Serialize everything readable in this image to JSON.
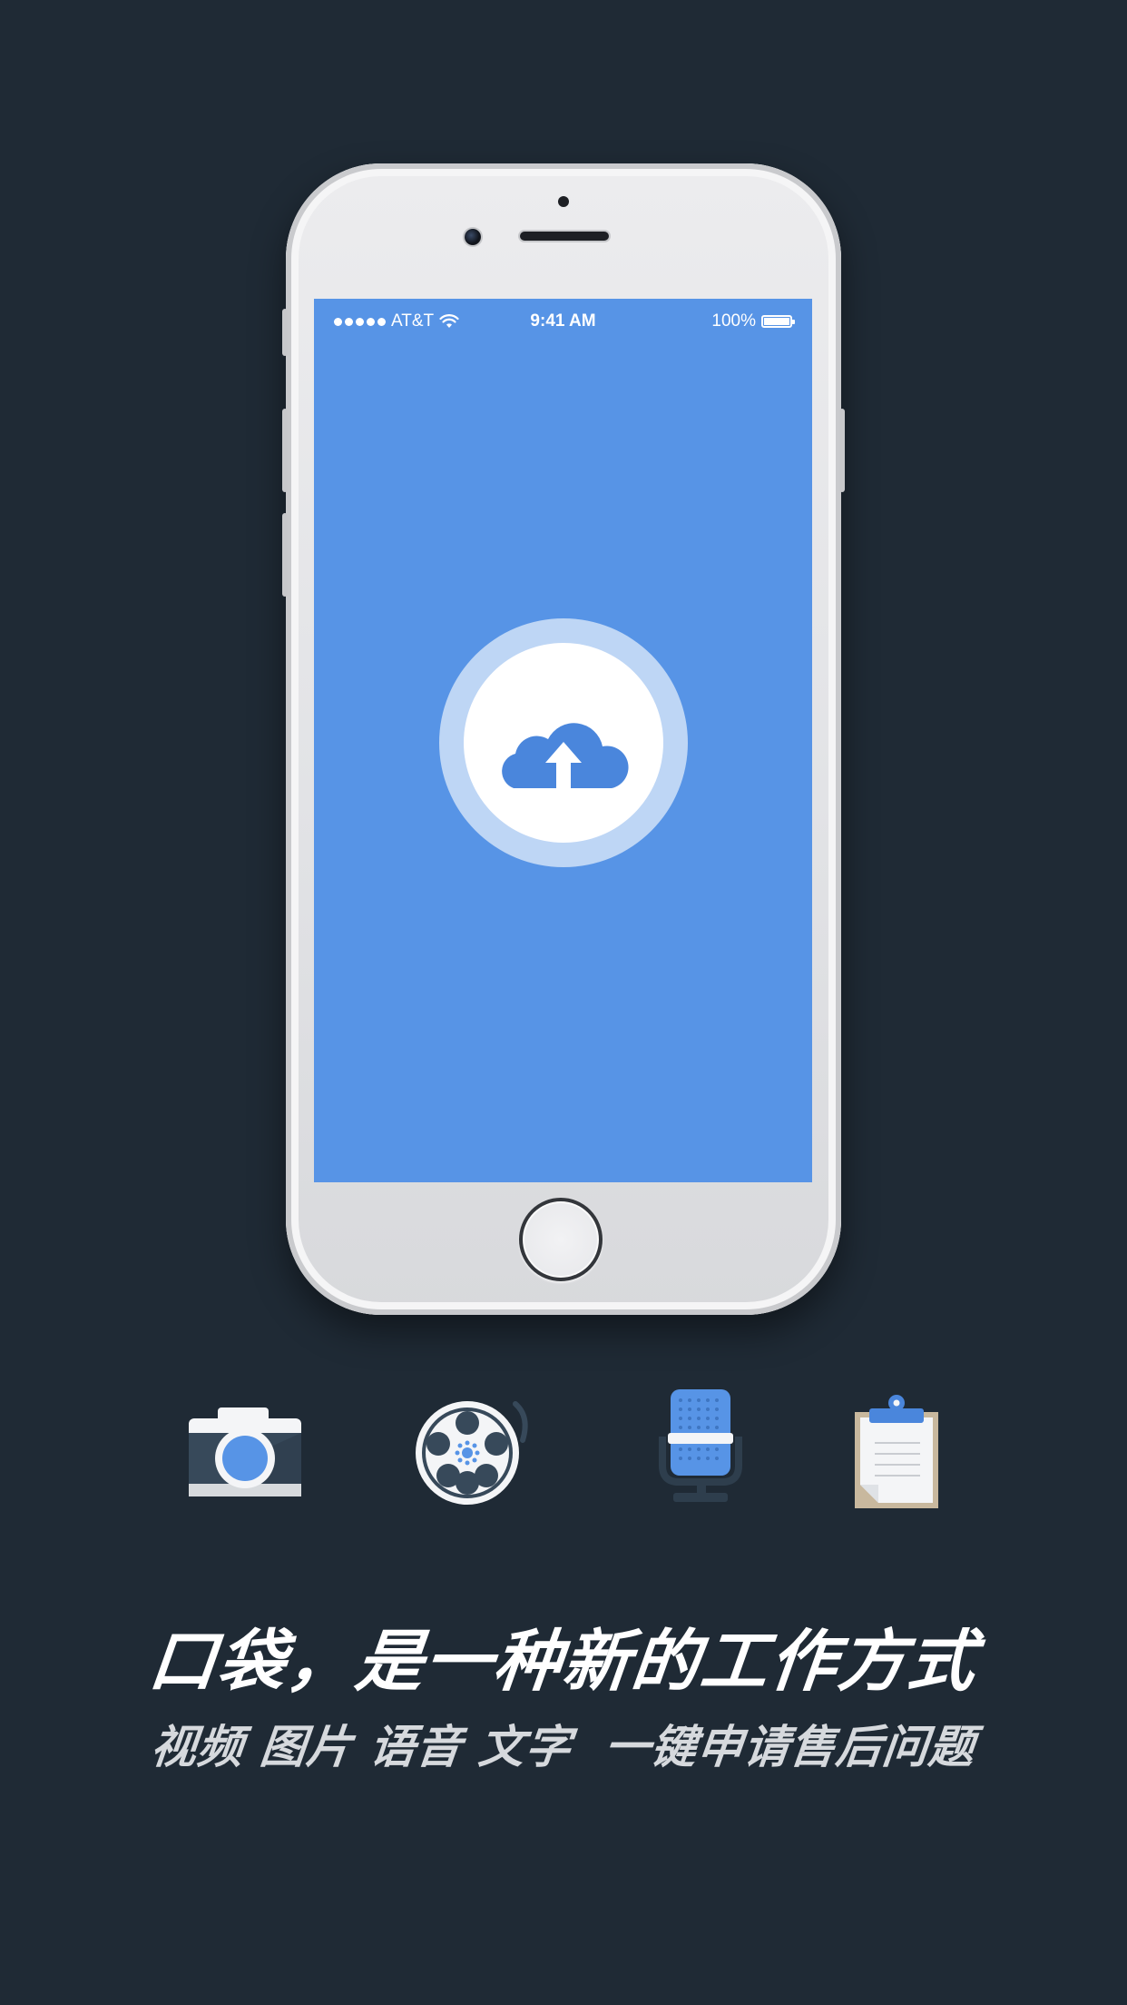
{
  "status_bar": {
    "carrier": "AT&T",
    "time": "9:41 AM",
    "battery": "100%"
  },
  "screen": {
    "background_color": "#5794e6",
    "center_icon": "cloud-upload-icon"
  },
  "feature_icons": [
    {
      "name": "camera-icon"
    },
    {
      "name": "film-reel-icon"
    },
    {
      "name": "microphone-icon"
    },
    {
      "name": "clipboard-icon"
    }
  ],
  "headline": "口袋，是一种新的工作方式",
  "subline": "视频 图片 语音 文字  一键申请售后问题",
  "colors": {
    "page_background": "#1f2a35",
    "accent_blue": "#5794e6"
  }
}
